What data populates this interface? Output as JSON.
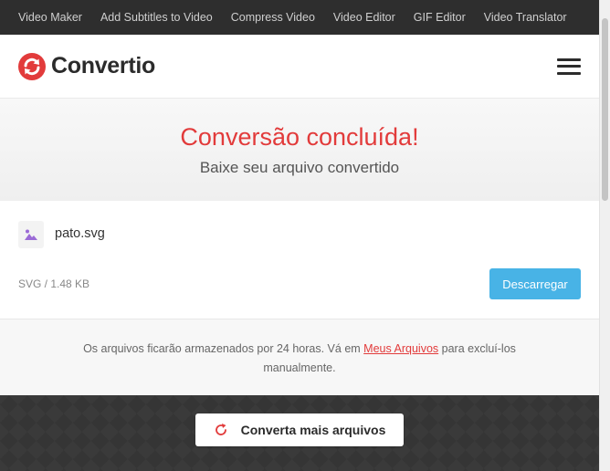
{
  "topnav": {
    "items": [
      {
        "label": "Video Maker"
      },
      {
        "label": "Add Subtitles to Video"
      },
      {
        "label": "Compress Video"
      },
      {
        "label": "Video Editor"
      },
      {
        "label": "GIF Editor"
      },
      {
        "label": "Video Translator"
      }
    ]
  },
  "header": {
    "logo_text": "Convertio",
    "menu_icon": "hamburger-menu-icon"
  },
  "hero": {
    "title": "Conversão concluída!",
    "subtitle": "Baixe seu arquivo convertido"
  },
  "file": {
    "name": "pato.svg",
    "meta": "SVG / 1.48 KB",
    "icon": "image-file-icon",
    "download_label": "Descarregar"
  },
  "note": {
    "before": "Os arquivos ficarão armazenados por 24 horas. Vá em ",
    "link": "Meus Arquivos",
    "after": " para excluí-los manualmente."
  },
  "bottom": {
    "convert_more_label": "Converta mais arquivos",
    "icon": "refresh-icon"
  },
  "colors": {
    "accent_red": "#e23b3b",
    "button_blue": "#48b3e6",
    "dark_bg": "#2e2e2e"
  }
}
